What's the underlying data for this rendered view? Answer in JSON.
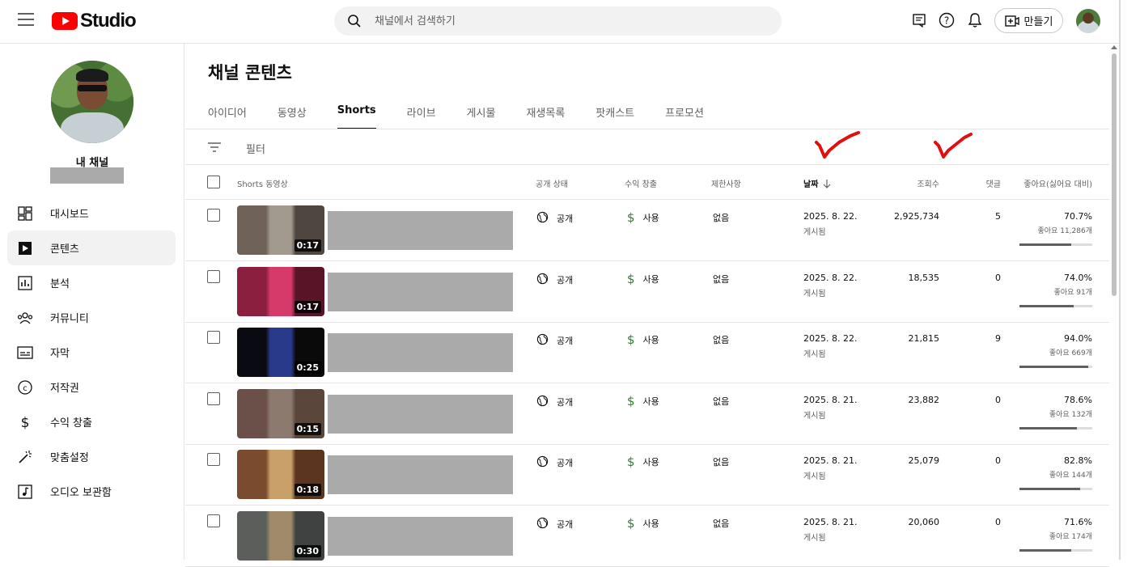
{
  "app": {
    "name": "Studio"
  },
  "search": {
    "placeholder": "채널에서 검색하기"
  },
  "header": {
    "create_label": "만들기"
  },
  "sidebar": {
    "channel_label": "내 채널",
    "items": [
      {
        "label": "대시보드",
        "icon": "dashboard-icon"
      },
      {
        "label": "콘텐츠",
        "icon": "content-icon",
        "active": true
      },
      {
        "label": "분석",
        "icon": "analytics-icon"
      },
      {
        "label": "커뮤니티",
        "icon": "community-icon"
      },
      {
        "label": "자막",
        "icon": "subtitles-icon"
      },
      {
        "label": "저작권",
        "icon": "copyright-icon"
      },
      {
        "label": "수익 창출",
        "icon": "dollar-icon"
      },
      {
        "label": "맞춤설정",
        "icon": "customize-icon"
      },
      {
        "label": "오디오 보관함",
        "icon": "audio-library-icon"
      }
    ]
  },
  "main": {
    "title": "채널 콘텐츠",
    "tabs": [
      "아이디어",
      "동영상",
      "Shorts",
      "라이브",
      "게시물",
      "재생목록",
      "팟캐스트",
      "프로모션"
    ],
    "active_tab": "Shorts",
    "filter_label": "필터"
  },
  "table": {
    "headers": {
      "video": "Shorts 동영상",
      "visibility": "공개 상태",
      "monetization": "수익 창출",
      "restrictions": "제한사항",
      "date": "날짜",
      "views": "조회수",
      "comments": "댓글",
      "likes": "좋아요(싫어요 대비)"
    },
    "sort_column": "date",
    "rows": [
      {
        "duration": "0:17",
        "visibility": "공개",
        "monetization": "사용",
        "restrictions": "없음",
        "date": "2025. 8. 22.",
        "status": "게시됨",
        "views": "2,925,734",
        "comments": "5",
        "like_pct": "70.7%",
        "like_count": "좋아요 11,286개",
        "like_ratio": 0.707,
        "thumb_colors": [
          "#6e6259",
          "#a39a8f",
          "#4f473f"
        ]
      },
      {
        "duration": "0:17",
        "visibility": "공개",
        "monetization": "사용",
        "restrictions": "없음",
        "date": "2025. 8. 22.",
        "status": "게시됨",
        "views": "18,535",
        "comments": "0",
        "like_pct": "74.0%",
        "like_count": "좋아요 91개",
        "like_ratio": 0.74,
        "thumb_colors": [
          "#8a1f3f",
          "#d63a6a",
          "#5a1428"
        ]
      },
      {
        "duration": "0:25",
        "visibility": "공개",
        "monetization": "사용",
        "restrictions": "없음",
        "date": "2025. 8. 22.",
        "status": "게시됨",
        "views": "21,815",
        "comments": "9",
        "like_pct": "94.0%",
        "like_count": "좋아요 669개",
        "like_ratio": 0.94,
        "thumb_colors": [
          "#0a0a12",
          "#2a3a8a",
          "#0a0a0a"
        ]
      },
      {
        "duration": "0:15",
        "visibility": "공개",
        "monetization": "사용",
        "restrictions": "없음",
        "date": "2025. 8. 21.",
        "status": "게시됨",
        "views": "23,882",
        "comments": "0",
        "like_pct": "78.6%",
        "like_count": "좋아요 132개",
        "like_ratio": 0.786,
        "thumb_colors": [
          "#6a5048",
          "#8d7a6e",
          "#5b463c"
        ]
      },
      {
        "duration": "0:18",
        "visibility": "공개",
        "monetization": "사용",
        "restrictions": "없음",
        "date": "2025. 8. 21.",
        "status": "게시됨",
        "views": "25,079",
        "comments": "0",
        "like_pct": "82.8%",
        "like_count": "좋아요 144개",
        "like_ratio": 0.828,
        "thumb_colors": [
          "#7a4b2e",
          "#c9a06a",
          "#5c3520"
        ]
      },
      {
        "duration": "0:30",
        "visibility": "공개",
        "monetization": "사용",
        "restrictions": "없음",
        "date": "2025. 8. 21.",
        "status": "게시됨",
        "views": "20,060",
        "comments": "0",
        "like_pct": "71.6%",
        "like_count": "좋아요 174개",
        "like_ratio": 0.716,
        "thumb_colors": [
          "#5b5e5a",
          "#a08a6a",
          "#3f4240"
        ]
      }
    ]
  },
  "colors": {
    "brand": "#ff0000",
    "annotation": "#e01010",
    "money": "#2e7d32"
  }
}
